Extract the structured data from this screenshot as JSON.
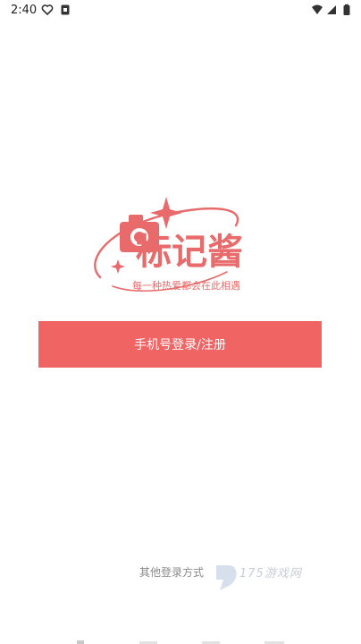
{
  "status_bar": {
    "time": "2:40",
    "left_icons": [
      "heart-outline-icon",
      "notification-square-icon"
    ],
    "right_icons": [
      "wifi-icon",
      "signal-icon",
      "battery-icon"
    ]
  },
  "logo": {
    "title": "标记酱",
    "slogan": "每一种热爱都会在此相遇",
    "color": "#e86a6a"
  },
  "login": {
    "phone_button_label": "手机号登录/注册",
    "button_color": "#f06464",
    "other_methods_label": "其他登录方式"
  },
  "watermark": {
    "text": "175游戏网"
  }
}
